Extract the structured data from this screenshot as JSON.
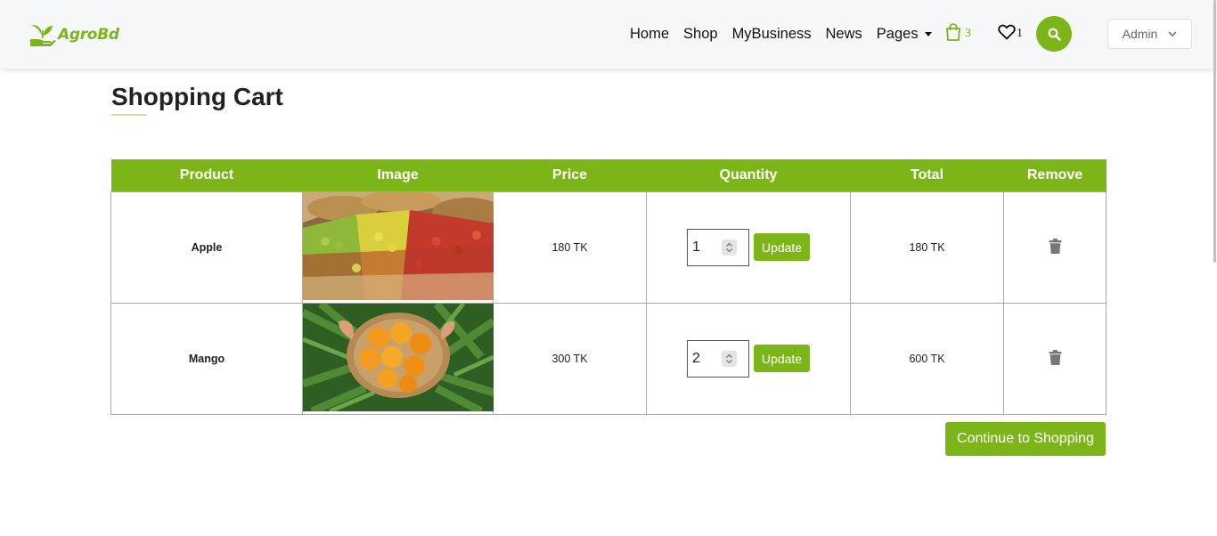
{
  "brand": {
    "name": "AgroBd",
    "color": "#7cb518"
  },
  "nav": {
    "links": [
      "Home",
      "Shop",
      "MyBusiness",
      "News"
    ],
    "pages_label": "Pages",
    "cart_count": "3",
    "wishlist_count": "1",
    "admin_label": "Admin"
  },
  "page": {
    "title": "Shopping Cart"
  },
  "table": {
    "headers": [
      "Product",
      "Image",
      "Price",
      "Quantity",
      "Total",
      "Remove"
    ],
    "rows": [
      {
        "product": "Apple",
        "image": "apple-market-photo",
        "price": "180 TK",
        "quantity": "1",
        "update_label": "Update",
        "total": "180 TK"
      },
      {
        "product": "Mango",
        "image": "mango-basket-photo",
        "price": "300 TK",
        "quantity": "2",
        "update_label": "Update",
        "total": "600 TK"
      }
    ]
  },
  "actions": {
    "continue_label": "Continue to Shopping"
  },
  "icons": {
    "cart": "shopping-bag-icon",
    "wishlist": "heart-icon",
    "search": "search-icon",
    "remove": "trash-icon",
    "admin_dropdown": "chevron-down-icon"
  }
}
